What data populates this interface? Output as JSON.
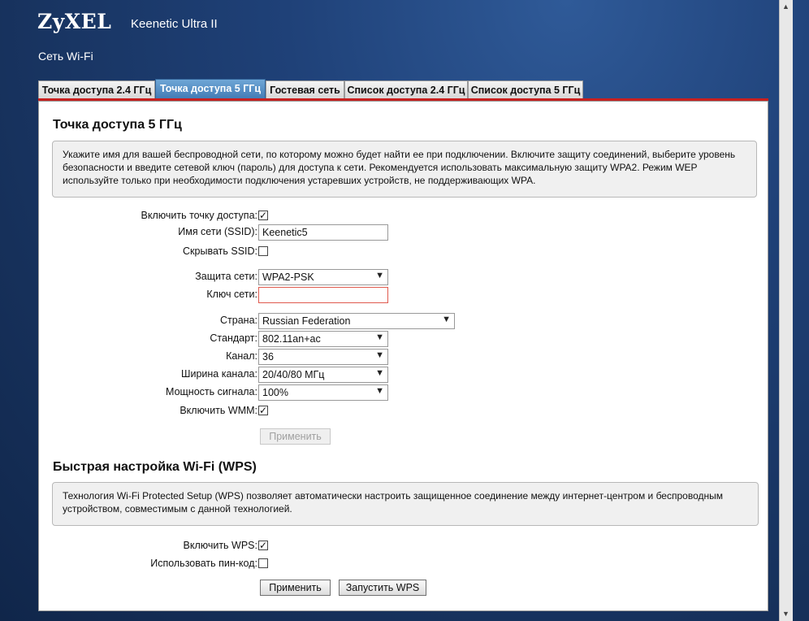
{
  "header": {
    "brand": "ZyXEL",
    "model": "Keenetic Ultra II",
    "section": "Сеть Wi-Fi"
  },
  "tabs": [
    {
      "label": "Точка доступа 2.4 ГГц",
      "active": false
    },
    {
      "label": "Точка доступа 5 ГГц",
      "active": true
    },
    {
      "label": "Гостевая сеть",
      "active": false
    },
    {
      "label": "Список доступа 2.4 ГГц",
      "active": false
    },
    {
      "label": "Список доступа 5 ГГц",
      "active": false
    }
  ],
  "ap": {
    "title": "Точка доступа 5 ГГц",
    "info": "Укажите имя для вашей беспроводной сети, по которому можно будет найти ее при подключении. Включите защиту соединений, выберите уровень безопасности и введите сетевой ключ (пароль) для доступа к сети. Рекомендуется использовать максимальную защиту WPA2. Режим WEP используйте только при необходимости подключения устаревших устройств, не поддерживающих WPA.",
    "enable_label": "Включить точку доступа:",
    "enable_checked": true,
    "ssid_label": "Имя сети (SSID):",
    "ssid_value": "Keenetic5",
    "hide_ssid_label": "Скрывать SSID:",
    "hide_ssid_checked": false,
    "security_label": "Защита сети:",
    "security_value": "WPA2-PSK",
    "key_label": "Ключ сети:",
    "key_value": "",
    "country_label": "Страна:",
    "country_value": "Russian Federation",
    "standard_label": "Стандарт:",
    "standard_value": "802.11an+ac",
    "channel_label": "Канал:",
    "channel_value": "36",
    "width_label": "Ширина канала:",
    "width_value": "20/40/80 МГц",
    "power_label": "Мощность сигнала:",
    "power_value": "100%",
    "wmm_label": "Включить WMM:",
    "wmm_checked": true,
    "apply_label": "Применить"
  },
  "wps": {
    "title": "Быстрая настройка Wi-Fi (WPS)",
    "info": "Технология Wi-Fi Protected Setup (WPS) позволяет автоматически настроить защищенное соединение между интернет-центром и беспроводным устройством, совместимым с данной технологией.",
    "enable_label": "Включить WPS:",
    "enable_checked": true,
    "pin_label": "Использовать пин-код:",
    "pin_checked": false,
    "apply_label": "Применить",
    "start_label": "Запустить WPS"
  },
  "icons": {
    "check": "✓",
    "dropdown": "chevron-down-icon"
  }
}
